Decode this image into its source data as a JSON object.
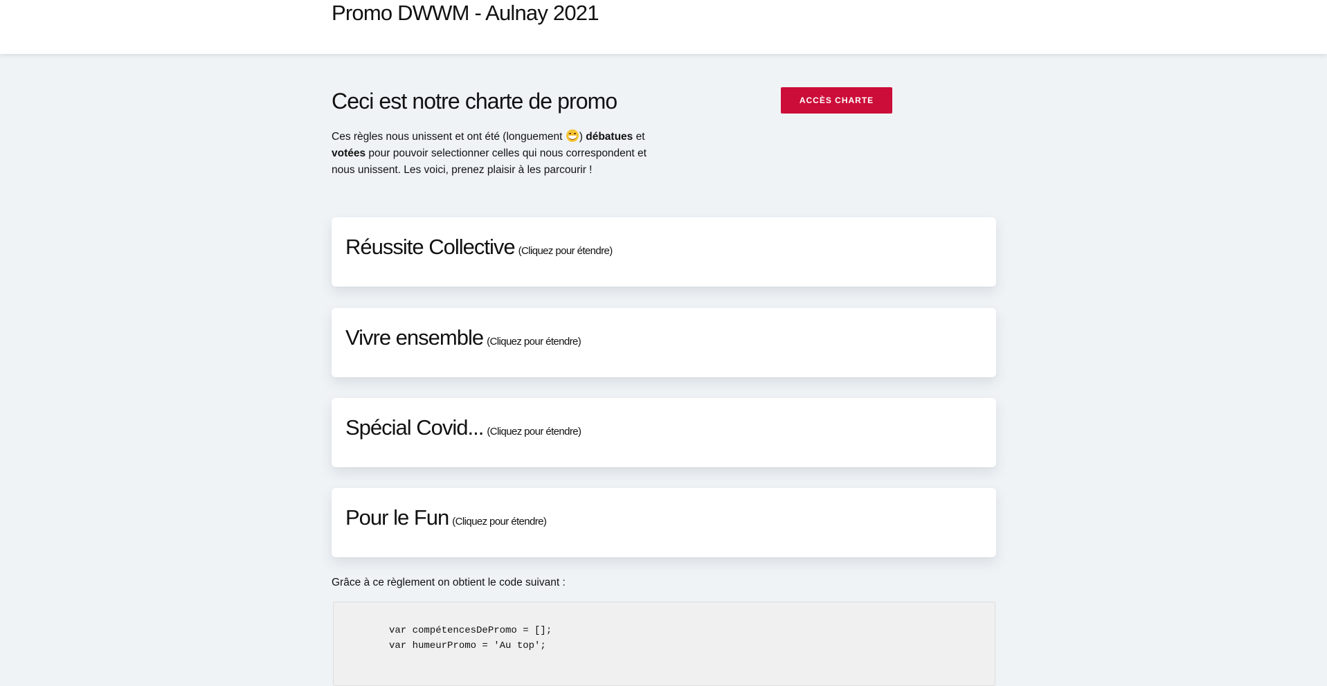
{
  "header": {
    "title": "Promo DWWM - Aulnay 2021"
  },
  "intro": {
    "title": "Ceci est notre charte de promo",
    "text_part1": "Ces règles nous unissent et ont été (longuement ",
    "text_part2": ") ",
    "bold1": "débatues",
    "text_part3": " et ",
    "bold2": "votées",
    "text_part4": " pour pouvoir selectionner celles qui nous correspondent et nous unissent. Les voici, prenez plaisir à les parcourir !",
    "emoji_icon": "grinning-sweat-emoji"
  },
  "charte_button": {
    "label": "ACCÈS CHARTE",
    "color": "#cc0c39"
  },
  "sections": [
    {
      "title": "Réussite Collective",
      "hint": "(Cliquez pour étendre)"
    },
    {
      "title": "Vivre ensemble",
      "hint": "(Cliquez pour étendre)"
    },
    {
      "title": "Spécial Covid...",
      "hint": "(Cliquez pour étendre)"
    },
    {
      "title": "Pour le Fun",
      "hint": "(Cliquez pour étendre)"
    }
  ],
  "code": {
    "intro": "Grâce à ce règlement on obtient le code suivant :",
    "lines": [
      "var compétencesDePromo = [];",
      "var humeurPromo = 'Au top';"
    ]
  }
}
